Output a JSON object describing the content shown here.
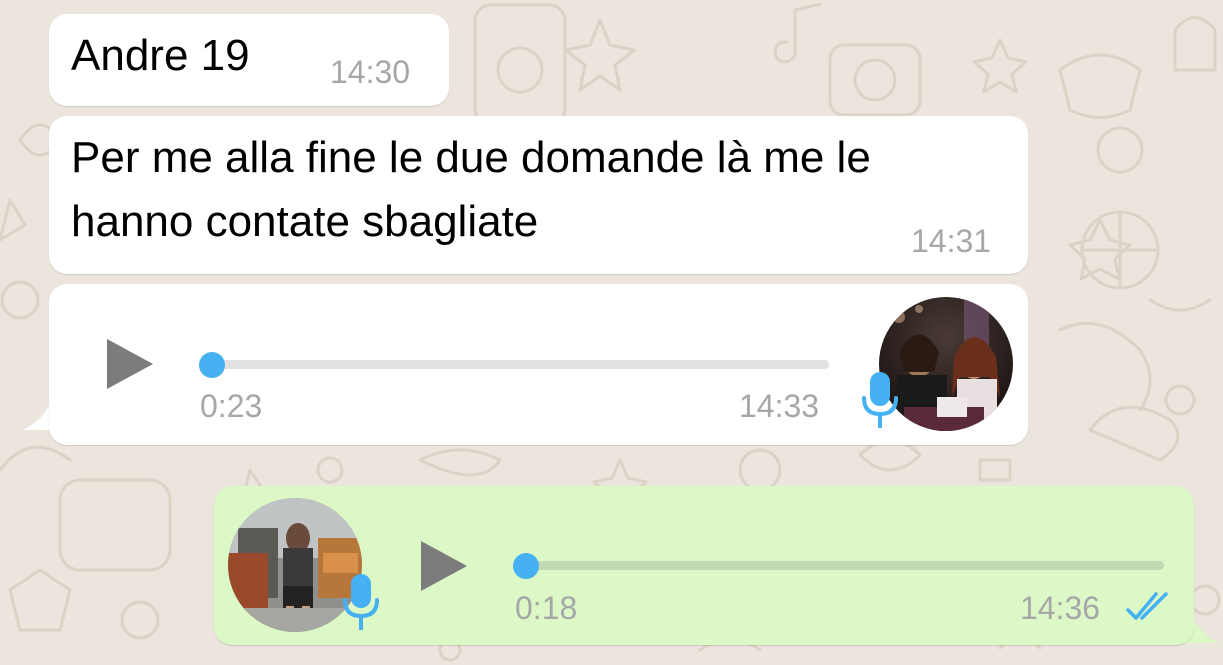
{
  "chat": {
    "messages": [
      {
        "type": "text",
        "direction": "incoming",
        "text": "Andre 19",
        "time": "14:30"
      },
      {
        "type": "text",
        "direction": "incoming",
        "lines": [
          "Per me alla fine le due domande là me le",
          "hanno contate sbagliate"
        ],
        "time": "14:31"
      },
      {
        "type": "voice",
        "direction": "incoming",
        "duration": "0:23",
        "time": "14:33",
        "progress": 0,
        "icons": [
          "play-icon",
          "microphone-icon",
          "avatar"
        ]
      },
      {
        "type": "voice",
        "direction": "outgoing",
        "duration": "0:18",
        "time": "14:36",
        "progress": 0,
        "status": "read",
        "icons": [
          "play-icon",
          "microphone-icon",
          "double-check-icon",
          "avatar"
        ]
      }
    ]
  },
  "colors": {
    "background": "#ece5dd",
    "incoming_bubble": "#ffffff",
    "outgoing_bubble": "#dcf8c6",
    "accent_blue": "#45b1f2",
    "time_gray": "#a7a7a7",
    "play_gray": "#7c7c7c"
  }
}
